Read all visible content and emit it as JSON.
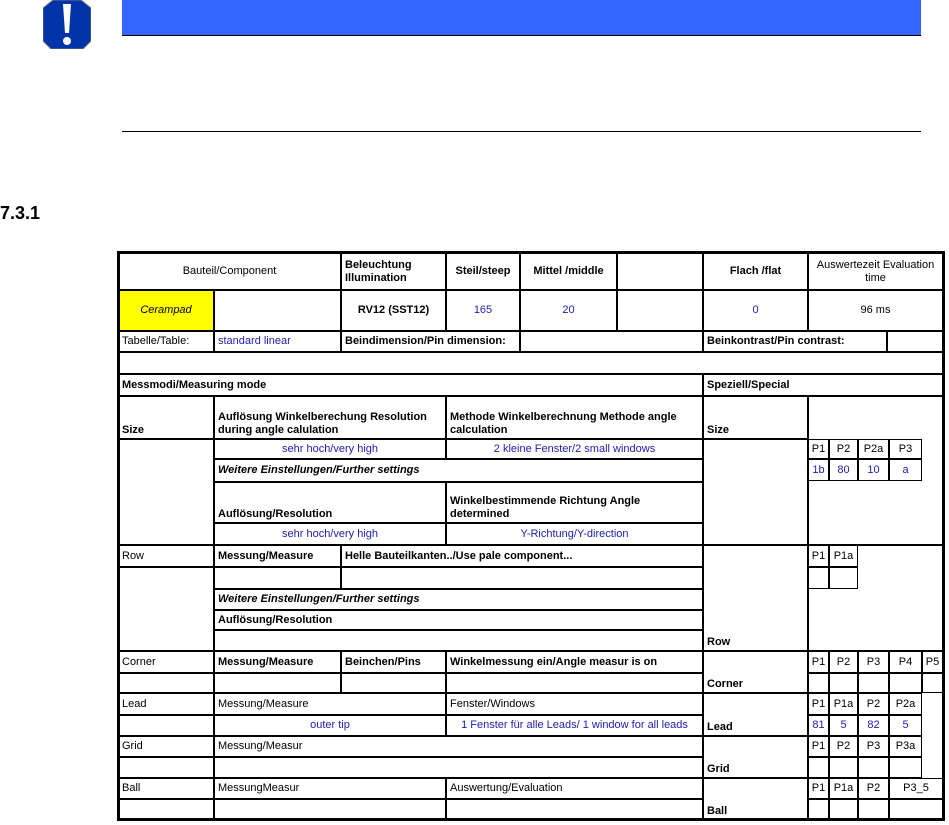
{
  "alert": {
    "icon": "exclamation-warning-icon",
    "bar_color": "#3366ff"
  },
  "heading": "7.3.1",
  "header": {
    "component": "Bauteil/Component",
    "illumination": "Beleuchtung Illumination",
    "steep": "Steil/steep",
    "middle": "Mittel /middle",
    "flat": "Flach /flat",
    "eval_time": "Auswertezeit Evaluation time"
  },
  "values": {
    "component": "Cerampad",
    "illumination": "RV12 (SST12)",
    "steep": "165",
    "middle": "20",
    "flat": "0",
    "eval_time": "96 ms"
  },
  "table_row": {
    "table_label": "Tabelle/Table:",
    "table_value": "standard linear",
    "pin_dim": "Beindimension/Pin dimension:",
    "pin_contrast": "Beinkontrast/Pin contrast:"
  },
  "sections": {
    "measuring_mode": "Messmodi/Measuring mode",
    "special": "Speziell/Special"
  },
  "size": {
    "label": "Size",
    "res_angle": "Auflösung Winkelberechung Resolution during angle calulation",
    "method_angle": "Methode Winkelberechnung          Methode angle calculation",
    "res_angle_value": "sehr hoch/very high",
    "method_value": "2 kleine Fenster/2 small windows",
    "further": "Weitere Einstellungen/Further settings",
    "resolution": "Auflösung/Resolution",
    "angle_dir": "Winkelbestimmende Richtung          Angle determined",
    "resolution_value": "sehr hoch/very high",
    "angle_dir_value": "Y-Richtung/Y-direction",
    "special_label": "Size",
    "params": [
      "P1",
      "P2",
      "P2a",
      "P3"
    ],
    "param_values": [
      "1b",
      "80",
      "10",
      "a"
    ]
  },
  "row": {
    "label": "Row",
    "measure": "Messung/Measure",
    "pale": "Helle Bauteilkanten../Use pale component...",
    "further": "Weitere Einstellungen/Further settings",
    "resolution": "Auflösung/Resolution",
    "special_label": "Row",
    "params": [
      "P1",
      "P1a"
    ]
  },
  "corner": {
    "label": "Corner",
    "measure": "Messung/Measure",
    "pins": "Beinchen/Pins",
    "angle": "Winkelmessung ein/Angle measur is on",
    "special_label": "Corner",
    "params": [
      "P1",
      "P2",
      "P3",
      "P4",
      "P5"
    ]
  },
  "lead": {
    "label": "Lead",
    "measure": "Messung/Measure",
    "windows": "Fenster/Windows",
    "measure_value": "outer tip",
    "windows_value": "1 Fenster für alle Leads/ 1 window for all leads",
    "special_label": "Lead",
    "params": [
      "P1",
      "P1a",
      "P2",
      "P2a"
    ],
    "param_values": [
      "81",
      "5",
      "82",
      "5"
    ]
  },
  "grid": {
    "label": "Grid",
    "measure": "Messung/Measur",
    "special_label": "Grid",
    "params": [
      "P1",
      "P2",
      "P3",
      "P3a"
    ]
  },
  "ball": {
    "label": "Ball",
    "measure": "MessungMeasur",
    "evaluation": "Auswertung/Evaluation",
    "special_label": "Ball",
    "params": [
      "P1",
      "P1a",
      "P2",
      "P3_5"
    ]
  }
}
